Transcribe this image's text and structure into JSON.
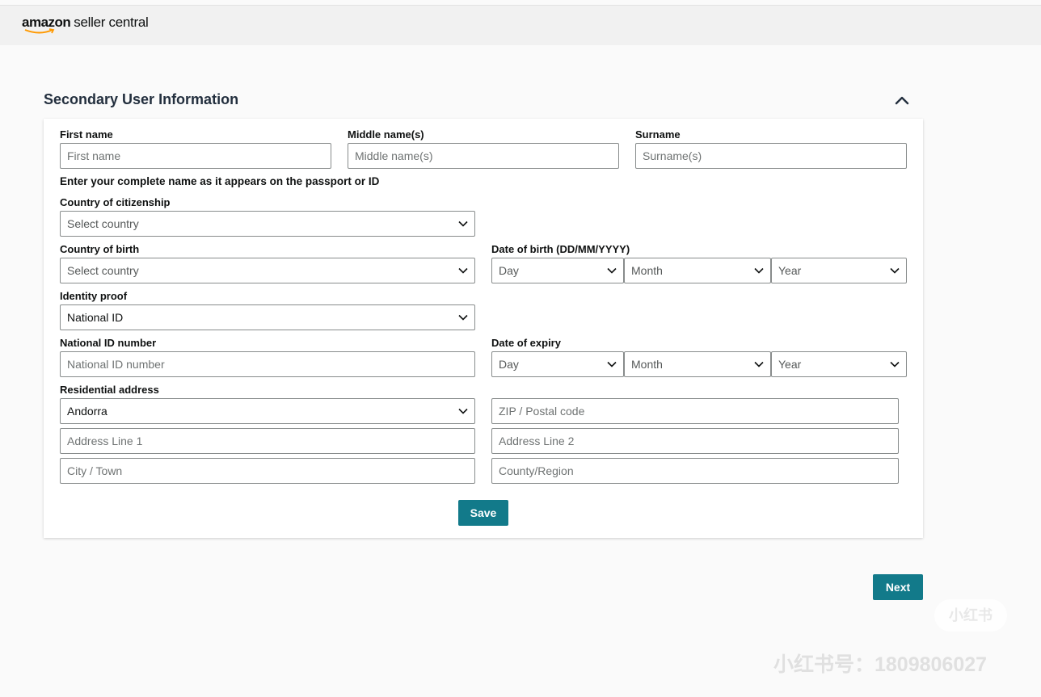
{
  "header": {
    "logo_amazon": "amazon",
    "logo_suffix": "seller central"
  },
  "section": {
    "title": "Secondary User Information"
  },
  "form": {
    "first_name": {
      "label": "First name",
      "placeholder": "First name"
    },
    "middle_name": {
      "label": "Middle name(s)",
      "placeholder": "Middle name(s)"
    },
    "surname": {
      "label": "Surname",
      "placeholder": "Surname(s)"
    },
    "name_hint": "Enter your complete name as it appears on the passport or ID",
    "citizenship": {
      "label": "Country of citizenship",
      "value": "Select country"
    },
    "birth_country": {
      "label": "Country of birth",
      "value": "Select country"
    },
    "dob": {
      "label": "Date of birth (DD/MM/YYYY)",
      "day": "Day",
      "month": "Month",
      "year": "Year"
    },
    "identity_proof": {
      "label": "Identity proof",
      "value": "National ID"
    },
    "id_number": {
      "label": "National ID number",
      "placeholder": "National ID number"
    },
    "expiry": {
      "label": "Date of expiry",
      "day": "Day",
      "month": "Month",
      "year": "Year"
    },
    "address": {
      "label": "Residential address",
      "country": "Andorra",
      "zip_placeholder": "ZIP / Postal code",
      "line1_placeholder": "Address Line 1",
      "line2_placeholder": "Address Line 2",
      "city_placeholder": "City / Town",
      "region_placeholder": "County/Region"
    },
    "save_label": "Save"
  },
  "footer": {
    "next_label": "Next"
  },
  "watermark": {
    "pill": "小红书",
    "id_text": "小红书号：1809806027"
  },
  "icons": {
    "collapse": "chevron-up-icon",
    "dropdown": "chevron-down-icon"
  },
  "colors": {
    "accent": "#127a8a",
    "header_bg": "#f1f1f1",
    "page_bg": "#fafafa"
  }
}
